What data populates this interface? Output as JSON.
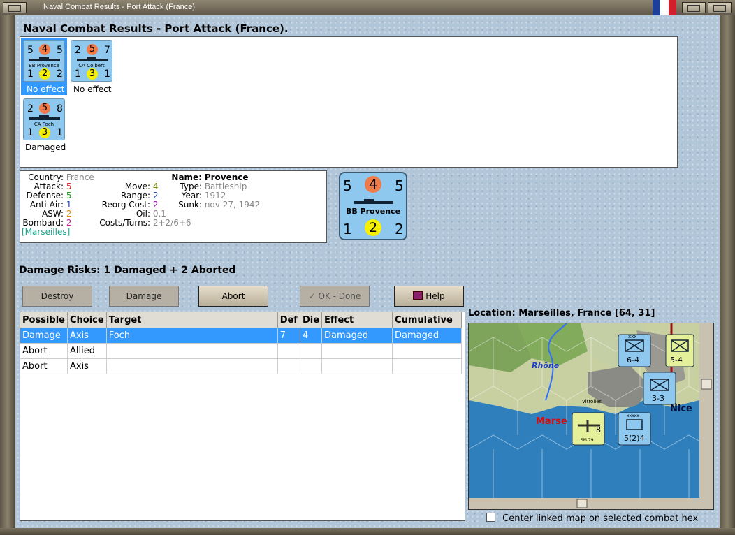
{
  "window": {
    "title": "Naval Combat Results - Port Attack (France)",
    "flag_colors": [
      "#1d3f9a",
      "#ffffff",
      "#d21f2b"
    ]
  },
  "heading": "Naval Combat Results - Port Attack (France).",
  "units": [
    {
      "top_left": "5",
      "top_mid": "4",
      "top_right": "5",
      "name": "BB Provence",
      "bot_left": "1",
      "bot_mid": "2",
      "bot_right": "2",
      "status": "No effect",
      "selected": true
    },
    {
      "top_left": "2",
      "top_mid": "5",
      "top_right": "7",
      "name": "CA Colbert",
      "bot_left": "1",
      "bot_mid": "3",
      "bot_right": "1",
      "status": "No effect",
      "selected": false
    },
    {
      "top_left": "2",
      "top_mid": "5",
      "top_right": "8",
      "name": "CA Foch",
      "bot_left": "1",
      "bot_mid": "3",
      "bot_right": "1",
      "status": "Damaged",
      "selected": false
    }
  ],
  "info": {
    "country_label": "Country:",
    "country": "France",
    "attack_label": "Attack:",
    "attack": "5",
    "defense_label": "Defense:",
    "defense": "5",
    "antiair_label": "Anti-Air:",
    "antiair": "1",
    "asw_label": "ASW:",
    "asw": "2",
    "bombard_label": "Bombard:",
    "bombard": "2",
    "location": "[Marseilles]",
    "move_label": "Move:",
    "move": "4",
    "range_label": "Range:",
    "range": "2",
    "reorg_label": "Reorg Cost:",
    "reorg": "2",
    "oil_label": "Oil:",
    "oil": "0,1",
    "costs_label": "Costs/Turns:",
    "costs": "2+2/6+6",
    "name_label": "Name:",
    "name": "Provence",
    "type_label": "Type:",
    "type": "Battleship",
    "year_label": "Year:",
    "year": "1912",
    "sunk_label": "Sunk:",
    "sunk": "nov 27, 1942"
  },
  "big_counter": {
    "top_left": "5",
    "top_mid": "4",
    "top_right": "5",
    "name": "BB Provence",
    "bot_left": "1",
    "bot_mid": "2",
    "bot_right": "2"
  },
  "damage_risks": "Damage Risks: 1 Damaged + 2 Aborted",
  "buttons": {
    "destroy": "Destroy",
    "damage": "Damage",
    "abort": "Abort",
    "ok": "OK - Done",
    "help": "Help"
  },
  "table": {
    "headers": [
      "Possible",
      "Choice",
      "Target",
      "Def",
      "Die",
      "Effect",
      "Cumulative"
    ],
    "rows": [
      [
        "Damage",
        "Axis",
        "Foch",
        "7",
        "4",
        "Damaged",
        "Damaged"
      ],
      [
        "Abort",
        "Allied",
        "",
        "",
        "",
        "",
        ""
      ],
      [
        "Abort",
        "Axis",
        "",
        "",
        "",
        "",
        ""
      ]
    ]
  },
  "location": "Location: Marseilles, France [64, 31]",
  "map_labels": {
    "rhone": "Rhône",
    "marseille": "Marse",
    "nice": "Nice",
    "vitrolles": "Vitrolles",
    "c1": "6-4",
    "c2": "5-4",
    "c3": "3-3",
    "c4": "5(2)4",
    "c5": "8",
    "c6": "SM.79",
    "c7": "xxx",
    "c8": "xxxxx"
  },
  "center_linked": "Center linked map on selected combat hex"
}
